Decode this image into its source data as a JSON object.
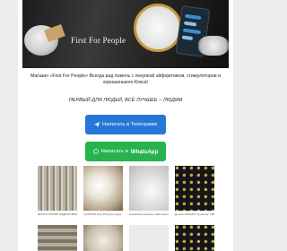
{
  "hero": {
    "brand": "First For People"
  },
  "intro": {
    "text": "Магазин «First For People» Всегда рад помочь с покупкой эйфоретиков, стимуляторов и хорошенького Кокса!"
  },
  "tagline": "ПЕРВЫЙ ДЛЯ ЛЮДЕЙ, ВСЁ ЛУЧШЕЕ – ЛЮДЯМ",
  "buttons": {
    "telegram_label": "Написать в Телеграмм",
    "whatsapp_prefix": "Написать в",
    "whatsapp_brand": "WhatsApp"
  },
  "products": [
    {
      "caption": "ФИНАЛ ОЛИМП РЕДКОЙ ВИНИЛ 1 (05 gr/шт)"
    },
    {
      "caption": "1(COB-00 sho) 200 gr/штудия · Мешков 1-2 Ширпа"
    },
    {
      "caption": "Кокаинбез кокаины (1ЕЕ ка/шишка) · Мешков 0,5 Ширпа"
    },
    {
      "caption": "Дешев 300 ЕРИ \"Гремлин\" 1ЕЕ Мешков 0 1-2 Ширпа"
    }
  ],
  "colors": {
    "telegram": "#2677d8",
    "whatsapp": "#26b34d",
    "page_bg": "#ececec"
  },
  "icons": {
    "telegram": "paper-plane-icon",
    "whatsapp": "whatsapp-icon"
  }
}
